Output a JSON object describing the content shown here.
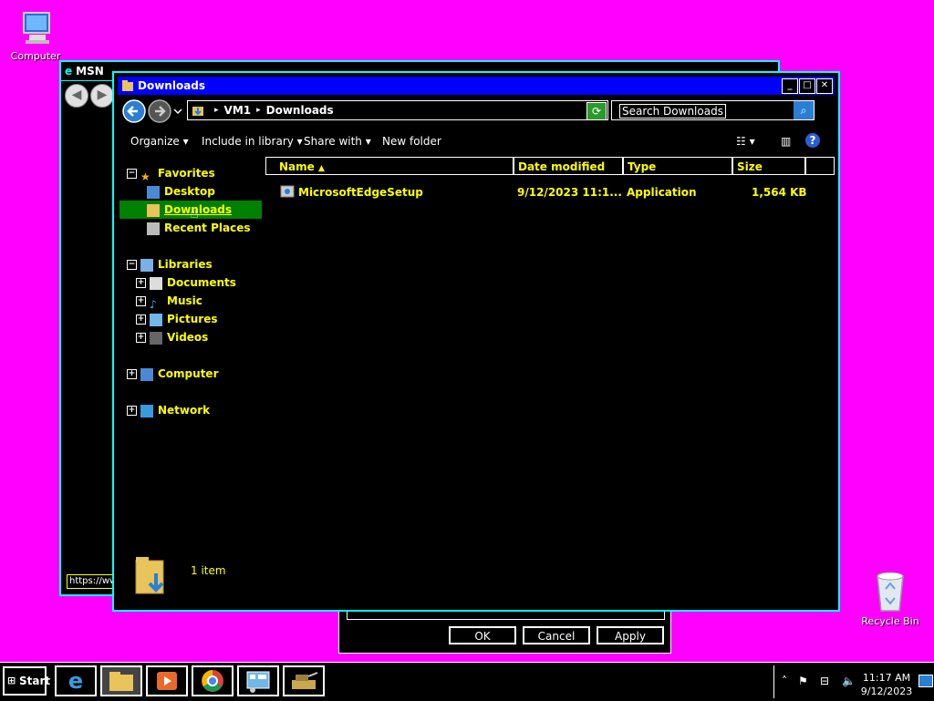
{
  "desktop": {
    "icons": [
      {
        "label": "Computer"
      },
      {
        "label": "Recycle Bin"
      }
    ]
  },
  "msn_window": {
    "title": "MSN",
    "status_text": "https://ww"
  },
  "dialog": {
    "ok": "OK",
    "cancel": "Cancel",
    "apply": "Apply"
  },
  "explorer": {
    "title": "Downloads",
    "breadcrumb": [
      "VM1",
      "Downloads"
    ],
    "search_placeholder": "Search Downloads",
    "toolbar": {
      "organize": "Organize",
      "include_in_library": "Include in library",
      "share_with": "Share with",
      "new_folder": "New folder"
    },
    "nav": {
      "favorites": "Favorites",
      "desktop": "Desktop",
      "downloads": "Downloads",
      "recent_places": "Recent Places",
      "libraries": "Libraries",
      "documents": "Documents",
      "music": "Music",
      "pictures": "Pictures",
      "videos": "Videos",
      "computer": "Computer",
      "network": "Network"
    },
    "columns": {
      "name": "Name",
      "date_modified": "Date modified",
      "type": "Type",
      "size": "Size"
    },
    "files": [
      {
        "name": "MicrosoftEdgeSetup",
        "date": "9/12/2023 11:1...",
        "type": "Application",
        "size": "1,564 KB"
      }
    ],
    "details": {
      "count": "1 item"
    }
  },
  "taskbar": {
    "start_label": "Start",
    "time": "11:17 AM",
    "date": "9/12/2023"
  },
  "colors": {
    "desktop_bg": "#ff00ff",
    "titlebar": "#0000ff",
    "highlight_text": "#ffff00",
    "selection": "#008000",
    "border": "#00ffff"
  }
}
